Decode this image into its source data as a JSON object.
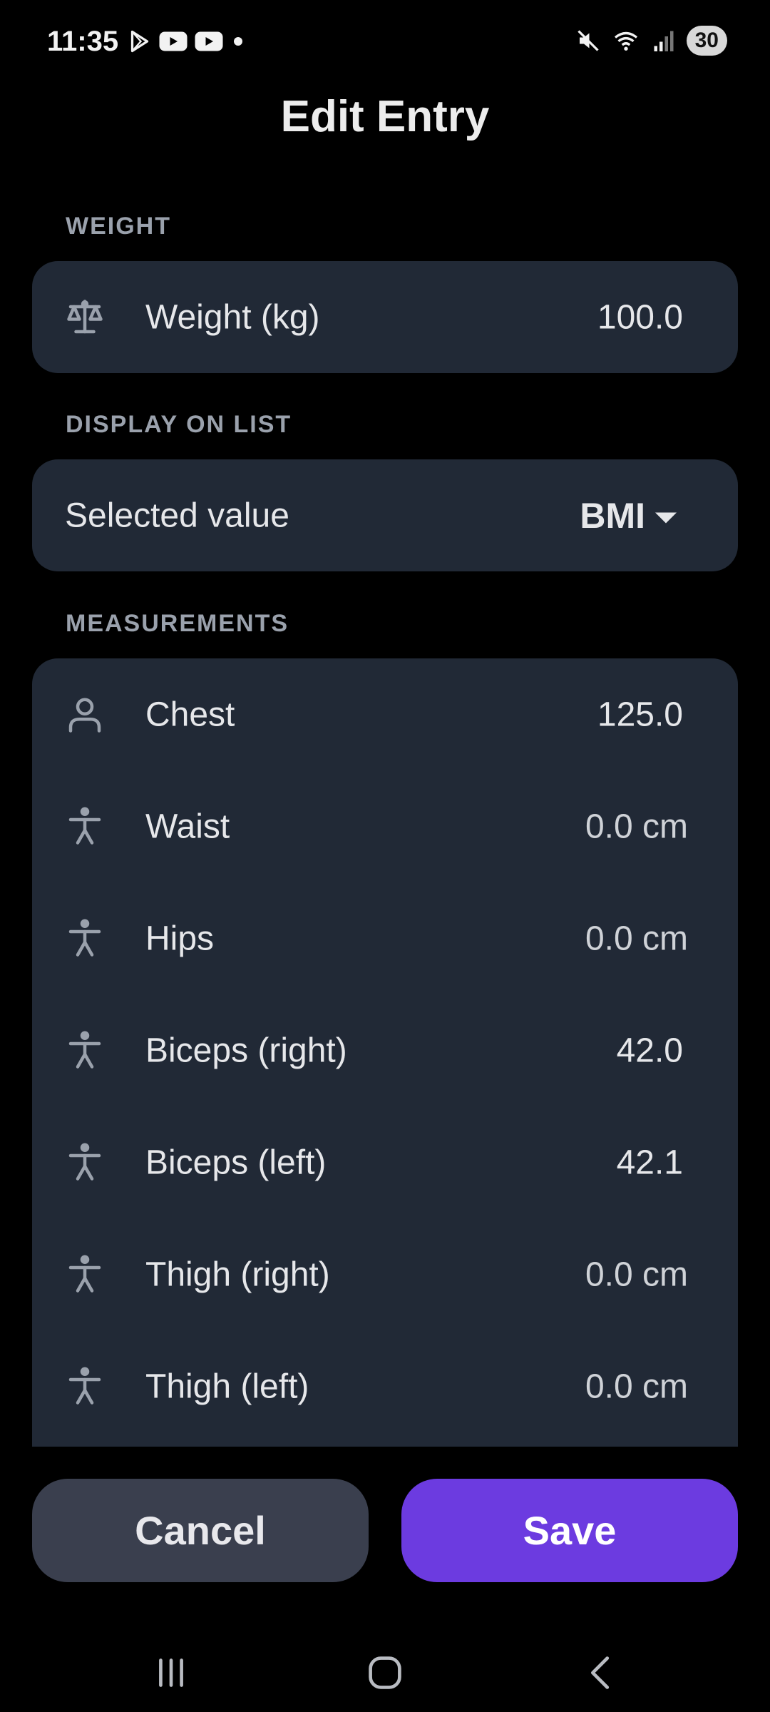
{
  "status_bar": {
    "time": "11:35",
    "battery": "30",
    "icons": [
      "play-store-icon",
      "youtube-icon",
      "youtube-icon",
      "dot-icon",
      "mute-icon",
      "wifi-icon",
      "signal-icon"
    ]
  },
  "title": "Edit Entry",
  "weight_section": {
    "label": "WEIGHT",
    "field": {
      "icon": "scale-icon",
      "label": "Weight (kg)",
      "value": "100.0"
    }
  },
  "display_section": {
    "label": "DISPLAY ON LIST",
    "select_label": "Selected value",
    "selected": "BMI"
  },
  "measurements_section": {
    "label": "MEASUREMENTS",
    "items": [
      {
        "icon": "person-icon",
        "label": "Chest",
        "value": "125.0"
      },
      {
        "icon": "body-icon",
        "label": "Waist",
        "value": "0.0 cm"
      },
      {
        "icon": "body-icon",
        "label": "Hips",
        "value": "0.0 cm"
      },
      {
        "icon": "body-icon",
        "label": "Biceps (right)",
        "value": "42.0"
      },
      {
        "icon": "body-icon",
        "label": "Biceps (left)",
        "value": "42.1"
      },
      {
        "icon": "body-icon",
        "label": "Thigh (right)",
        "value": "0.0 cm"
      },
      {
        "icon": "body-icon",
        "label": "Thigh (left)",
        "value": "0.0 cm"
      }
    ]
  },
  "buttons": {
    "cancel": "Cancel",
    "save": "Save"
  },
  "colors": {
    "background": "#000000",
    "card": "#212936",
    "accent": "#6c3be0",
    "cancel": "#3a3f4e"
  }
}
